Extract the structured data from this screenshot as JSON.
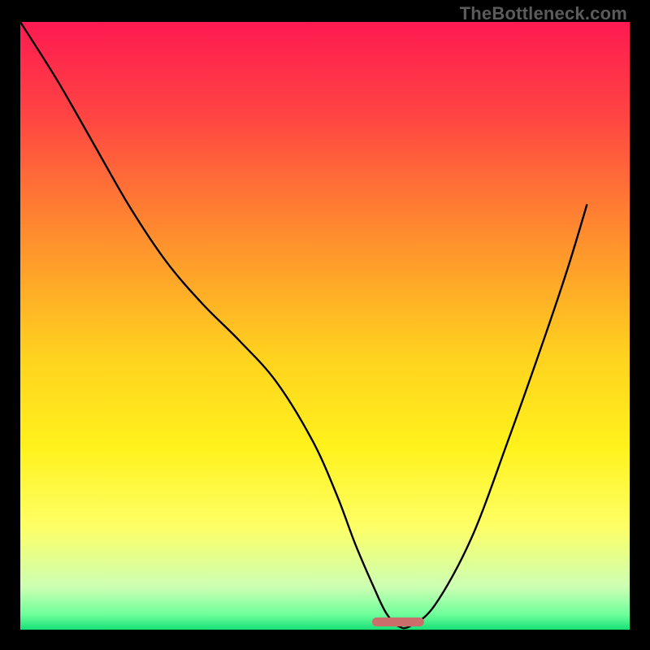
{
  "watermark": "TheBottleneck.com",
  "chart_data": {
    "type": "line",
    "title": "",
    "xlabel": "",
    "ylabel": "",
    "xlim": [
      0,
      100
    ],
    "ylim": [
      0,
      100
    ],
    "grid": false,
    "legend": false,
    "background_gradient": {
      "direction": "vertical",
      "stops": [
        {
          "pos": 0.0,
          "color": "#ff1a51"
        },
        {
          "pos": 0.15,
          "color": "#ff4343"
        },
        {
          "pos": 0.35,
          "color": "#ff8d2e"
        },
        {
          "pos": 0.55,
          "color": "#ffd21f"
        },
        {
          "pos": 0.7,
          "color": "#fff21c"
        },
        {
          "pos": 0.83,
          "color": "#feff66"
        },
        {
          "pos": 0.93,
          "color": "#ccffb3"
        },
        {
          "pos": 0.975,
          "color": "#6fff9b"
        },
        {
          "pos": 1.0,
          "color": "#17e077"
        }
      ]
    },
    "series": [
      {
        "name": "bottleneck-curve",
        "mode": "smooth",
        "color": "#000000",
        "stroke_width": 2.4,
        "x": [
          0,
          6,
          12,
          18,
          24,
          30,
          36,
          42,
          48,
          52,
          55,
          58,
          60,
          62,
          64,
          68,
          74,
          80,
          86,
          90,
          93
        ],
        "y": [
          100,
          90.5,
          80,
          69.5,
          60.5,
          53.5,
          47.5,
          40.8,
          31,
          22,
          14,
          7,
          2.8,
          0.6,
          0.6,
          4,
          15,
          31,
          48,
          60,
          70
        ]
      }
    ],
    "marker": {
      "name": "optimal-range",
      "center_x": 62,
      "width": 8.5,
      "y": 0.6,
      "height": 1.4,
      "color": "#cb6e6b"
    }
  }
}
